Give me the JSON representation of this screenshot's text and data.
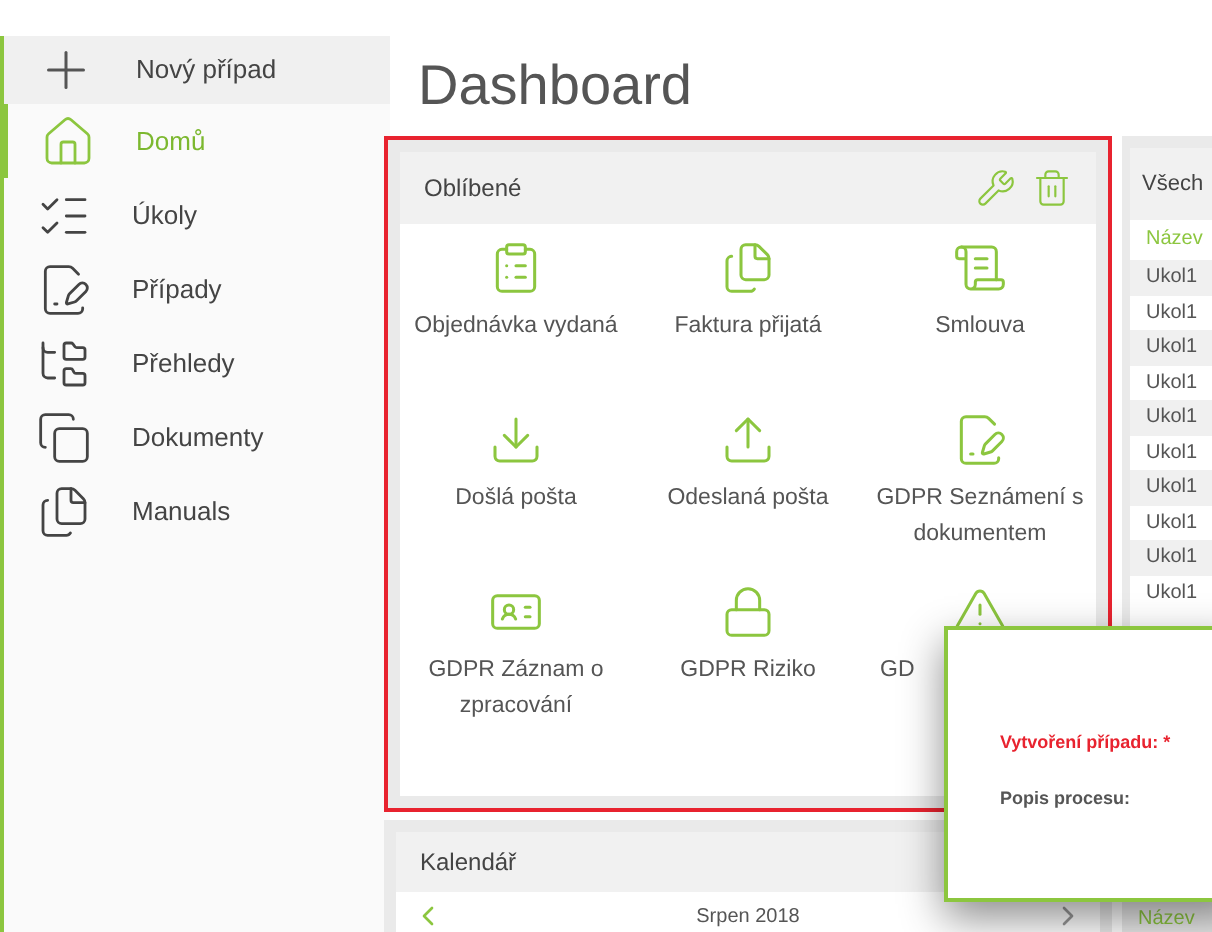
{
  "new_case": {
    "label": "Nový případ"
  },
  "sidebar": {
    "items": [
      {
        "label": "Domů",
        "kind": "home",
        "selected": true
      },
      {
        "label": "Úkoly",
        "kind": "tasks",
        "selected": false
      },
      {
        "label": "Případy",
        "kind": "cases",
        "selected": false
      },
      {
        "label": "Přehledy",
        "kind": "reports",
        "selected": false
      },
      {
        "label": "Dokumenty",
        "kind": "documents",
        "selected": false
      },
      {
        "label": "Manuals",
        "kind": "manuals",
        "selected": false
      }
    ]
  },
  "page": {
    "title": "Dashboard"
  },
  "favorites": {
    "title": "Oblíbené",
    "tiles": [
      {
        "label": "Objednávka vydaná",
        "kind": "checklist"
      },
      {
        "label": "Faktura přijatá",
        "kind": "files"
      },
      {
        "label": "Smlouva",
        "kind": "scroll"
      },
      {
        "label": "Došlá pošta",
        "kind": "download"
      },
      {
        "label": "Odeslaná pošta",
        "kind": "upload"
      },
      {
        "label": "GDPR Seznámení s dokumentem",
        "kind": "sign"
      },
      {
        "label": "GDPR Záznam o zpracování",
        "kind": "badge"
      },
      {
        "label": "GDPR Riziko",
        "kind": "lock"
      },
      {
        "label": "GD",
        "kind": "warning"
      }
    ]
  },
  "all_tasks": {
    "title": "Všech",
    "column": "Název",
    "rows": [
      "Ukol1",
      "Ukol1",
      "Ukol1",
      "Ukol1",
      "Ukol1",
      "Ukol1",
      "Ukol1",
      "Ukol1",
      "Ukol1",
      "Ukol1"
    ]
  },
  "calendar": {
    "title": "Kalendář",
    "month": "Srpen 2018"
  },
  "lower_list": {
    "column": "Název"
  },
  "dialog": {
    "required_label": "Vytvoření případu: *",
    "field_label": "Popis procesu:"
  }
}
